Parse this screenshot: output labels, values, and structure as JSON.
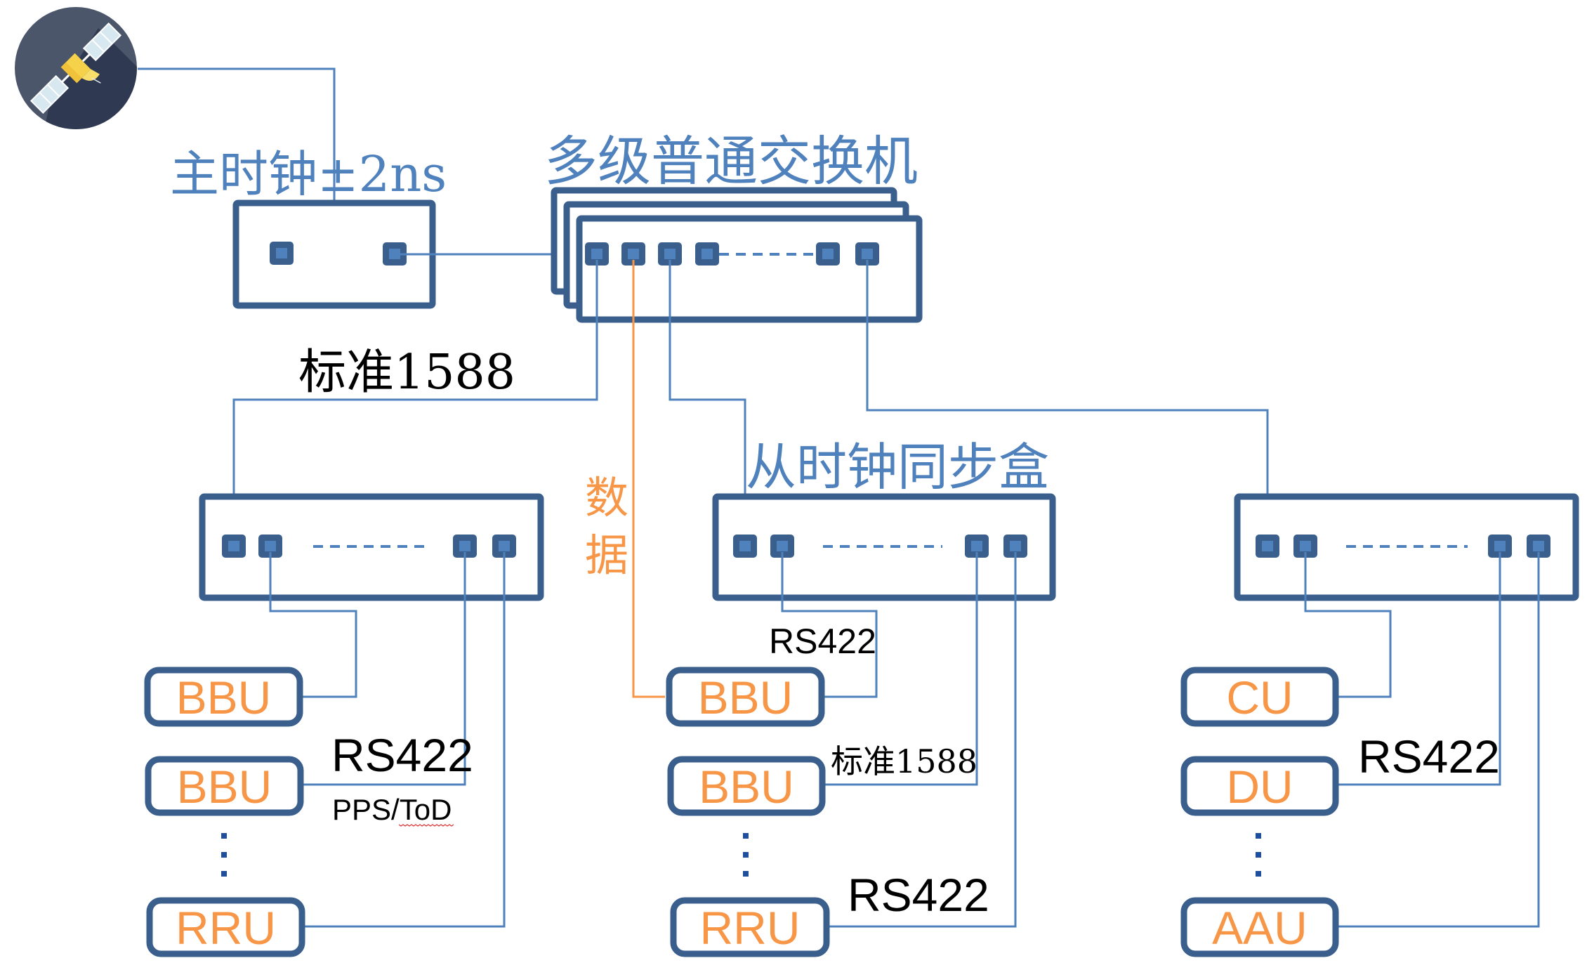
{
  "colors": {
    "box_stroke": "#3b5f8c",
    "wire": "#4f81bd",
    "data_wire": "#f79646",
    "title_text": "#4f81bd",
    "device_text": "#f79646",
    "satellite_bg": "#4b566b",
    "satellite_shadow": "#2f3a52",
    "satellite_panel": "#cfe3ee",
    "satellite_body": "#f5d24a"
  },
  "icons": {
    "satellite": "satellite-icon"
  },
  "master_clock": {
    "label": "主时钟±2ns"
  },
  "switch": {
    "title": "多级普通交换机"
  },
  "slave_sync_box": {
    "title": "从时钟同步盒"
  },
  "links": {
    "standard_1588": "标准1588",
    "data": [
      "数",
      "据"
    ]
  },
  "groups": [
    {
      "id": "left",
      "devices": [
        "BBU",
        "BBU",
        "RRU"
      ],
      "labels": {
        "rs422": "RS422",
        "pps_tod": "PPS/ToD"
      }
    },
    {
      "id": "middle",
      "devices": [
        "BBU",
        "BBU",
        "RRU"
      ],
      "labels": {
        "rs422_top": "RS422",
        "standard_1588": "标准1588",
        "rs422_bottom": "RS422"
      }
    },
    {
      "id": "right",
      "devices": [
        "CU",
        "DU",
        "AAU"
      ],
      "labels": {
        "rs422": "RS422"
      }
    }
  ]
}
